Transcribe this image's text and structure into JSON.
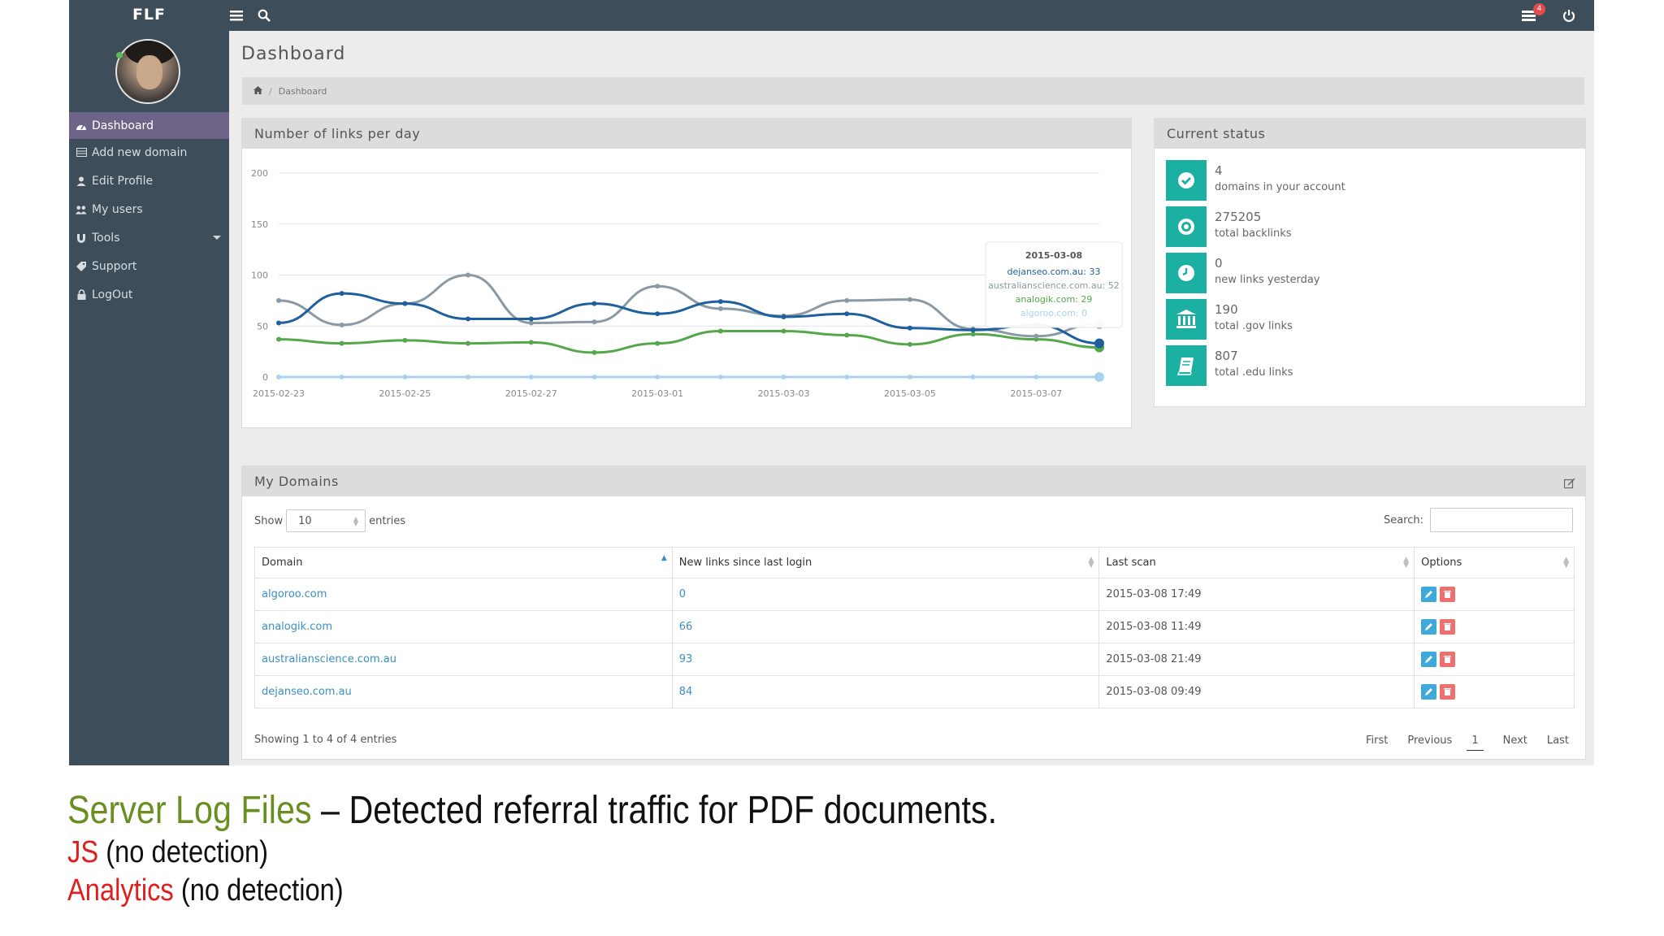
{
  "app": {
    "brand": "FLF",
    "message_count": "4"
  },
  "sidebar": {
    "items": [
      {
        "label": "Dashboard",
        "icon": "dashboard-icon"
      },
      {
        "label": "Add new domain",
        "icon": "table-icon"
      },
      {
        "label": "Edit Profile",
        "icon": "user-icon"
      },
      {
        "label": "My users",
        "icon": "users-icon"
      },
      {
        "label": "Tools",
        "icon": "magnet-icon"
      },
      {
        "label": "Support",
        "icon": "tag-icon"
      },
      {
        "label": "LogOut",
        "icon": "lock-icon"
      }
    ]
  },
  "header": {
    "title": "Dashboard",
    "breadcrumb": "Dashboard"
  },
  "chart_panel": {
    "title": "Number of links per day"
  },
  "chart_data": {
    "type": "line",
    "x": [
      "2015-02-23",
      "2015-02-24",
      "2015-02-25",
      "2015-02-26",
      "2015-02-27",
      "2015-02-28",
      "2015-03-01",
      "2015-03-02",
      "2015-03-03",
      "2015-03-04",
      "2015-03-05",
      "2015-03-06",
      "2015-03-07",
      "2015-03-08"
    ],
    "x_tick_labels": [
      "2015-02-23",
      "2015-02-25",
      "2015-02-27",
      "2015-03-01",
      "2015-03-03",
      "2015-03-05",
      "2015-03-07"
    ],
    "ylim": [
      0,
      200
    ],
    "y_ticks": [
      "0",
      "50",
      "100",
      "150",
      "200"
    ],
    "grid": true,
    "series": [
      {
        "name": "dejanseo.com.au",
        "color": "#1f5f9e",
        "values": [
          53,
          82,
          72,
          57,
          57,
          72,
          62,
          74,
          59,
          62,
          48,
          46,
          51,
          33
        ]
      },
      {
        "name": "australianscience.com.au",
        "color": "#8a99a6",
        "values": [
          75,
          51,
          72,
          100,
          53,
          54,
          89,
          67,
          60,
          75,
          76,
          47,
          40,
          52
        ]
      },
      {
        "name": "analogik.com",
        "color": "#55a84a",
        "values": [
          37,
          33,
          36,
          33,
          34,
          24,
          33,
          45,
          45,
          41,
          32,
          42,
          37,
          29
        ]
      },
      {
        "name": "algoroo.com",
        "color": "#a9d2f2",
        "values": [
          0,
          0,
          0,
          0,
          0,
          0,
          0,
          0,
          0,
          0,
          0,
          0,
          0,
          0
        ]
      }
    ],
    "tooltip": {
      "date": "2015-03-08",
      "lines": [
        "dejanseo.com.au: 33",
        "australianscience.com.au: 52",
        "analogik.com: 29",
        "algoroo.com: 0"
      ]
    }
  },
  "status_panel": {
    "title": "Current status",
    "items": [
      {
        "value": "4",
        "label": "domains in your account",
        "icon": "check-circle-icon"
      },
      {
        "value": "275205",
        "label": "total backlinks",
        "icon": "target-icon"
      },
      {
        "value": "0",
        "label": "new links yesterday",
        "icon": "clock-icon"
      },
      {
        "value": "190",
        "label": "total .gov links",
        "icon": "bank-icon"
      },
      {
        "value": "807",
        "label": "total .edu links",
        "icon": "book-icon"
      }
    ]
  },
  "domains_panel": {
    "title": "My Domains",
    "show_label": "Show",
    "entries_label": "entries",
    "page_length": "10",
    "search_label": "Search:",
    "search_value": "",
    "columns": [
      "Domain",
      "New links since last login",
      "Last scan",
      "Options"
    ],
    "rows": [
      {
        "domain": "algoroo.com",
        "new_links": "0",
        "last_scan": "2015-03-08 17:49"
      },
      {
        "domain": "analogik.com",
        "new_links": "66",
        "last_scan": "2015-03-08 11:49"
      },
      {
        "domain": "australianscience.com.au",
        "new_links": "93",
        "last_scan": "2015-03-08 21:49"
      },
      {
        "domain": "dejanseo.com.au",
        "new_links": "84",
        "last_scan": "2015-03-08 09:49"
      }
    ],
    "info": "Showing 1 to 4 of 4 entries",
    "pager": {
      "first": "First",
      "previous": "Previous",
      "current": "1",
      "next": "Next",
      "last": "Last"
    }
  },
  "caption": {
    "line1_highlight": "Server Log Files",
    "line1_rest": " – Detected referral traffic for PDF documents.",
    "line2_highlight": "JS",
    "line2_rest": " (no detection)",
    "line3_highlight": "Analytics",
    "line3_rest": " (no detection)"
  }
}
